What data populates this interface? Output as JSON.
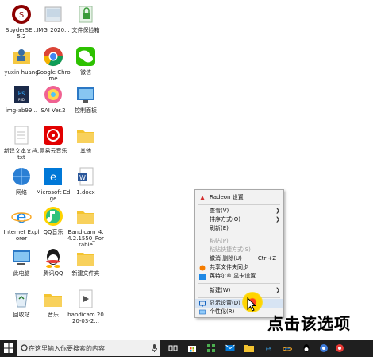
{
  "desktop_icons": [
    {
      "label": "SpyderSE...\n5.2",
      "icon": "spyder-app-icon"
    },
    {
      "label": "IMG_2020...",
      "icon": "image-file-icon"
    },
    {
      "label": "文件保险箱",
      "icon": "file-safe-icon"
    },
    {
      "label": "yuxin huang",
      "icon": "user-folder-icon"
    },
    {
      "label": "Google Chrome",
      "icon": "chrome-icon"
    },
    {
      "label": "微信",
      "icon": "wechat-icon"
    },
    {
      "label": "img-ab99...",
      "icon": "photoshop-file-icon"
    },
    {
      "label": "SAI Ver.2",
      "icon": "sai-app-icon"
    },
    {
      "label": "控制面板",
      "icon": "control-panel-icon"
    },
    {
      "label": "新建文本文档.txt",
      "icon": "text-file-icon"
    },
    {
      "label": "网易云音乐",
      "icon": "netease-music-icon"
    },
    {
      "label": "其他",
      "icon": "folder-icon"
    },
    {
      "label": "网络",
      "icon": "network-icon"
    },
    {
      "label": "Microsoft Edge",
      "icon": "edge-icon"
    },
    {
      "label": "1.docx",
      "icon": "word-file-icon"
    },
    {
      "label": "Internet Explorer",
      "icon": "internet-explorer-icon"
    },
    {
      "label": "QQ音乐",
      "icon": "qq-music-icon"
    },
    {
      "label": "Bandicam_4.4.2.1550_Portable",
      "icon": "folder-icon"
    },
    {
      "label": "此电脑",
      "icon": "this-pc-icon"
    },
    {
      "label": "腾讯QQ",
      "icon": "qq-icon"
    },
    {
      "label": "新建文件夹",
      "icon": "folder-icon"
    },
    {
      "label": "回收站",
      "icon": "recycle-bin-icon"
    },
    {
      "label": "音乐",
      "icon": "folder-icon"
    },
    {
      "label": "bandicam 2020-03-2...",
      "icon": "video-file-icon"
    }
  ],
  "context_menu": {
    "radeon": "Radeon 设置",
    "view": "查看(V)",
    "sort": "排序方式(O)",
    "refresh": "刷新(E)",
    "paste": "粘贴(P)",
    "paste_shortcut": "粘贴快捷方式(S)",
    "undo_delete": "撤消 删除(U)",
    "undo_shortcut": "Ctrl+Z",
    "share_sync": "共享文件夹同步",
    "intel_graphics": "英特尔® 显卡设置",
    "new": "新建(W)",
    "display_settings": "显示设置(D)",
    "personalize": "个性化(R)"
  },
  "instruction_text": "点击该选项",
  "taskbar": {
    "search_placeholder": "在这里输入你要搜索的内容"
  },
  "colors": {
    "taskbar_bg": "#1f1f1f",
    "menu_bg": "#f2f2f2",
    "menu_highlight": "#d7e4f3",
    "click_marker": "#ffd400"
  }
}
